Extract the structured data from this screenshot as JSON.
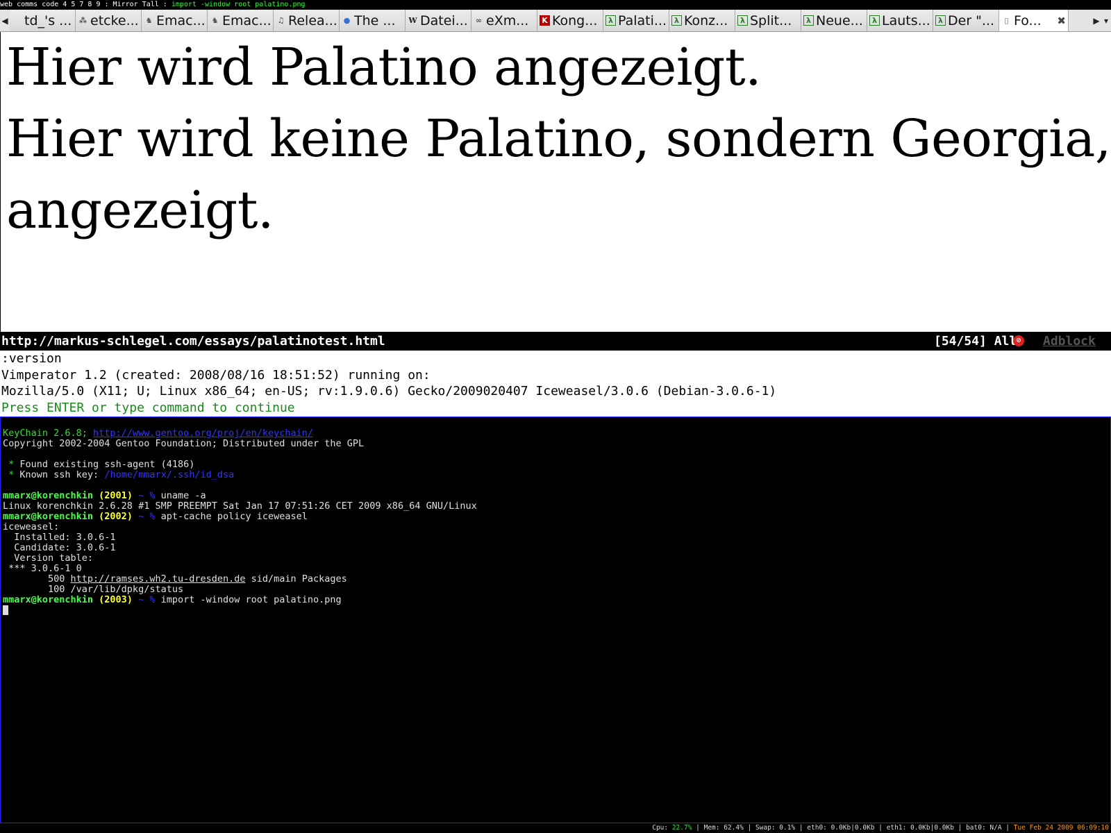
{
  "wm": {
    "left": "web comms code 4 5 7 8 9 : Mirror Tall : ",
    "command": "import -window root palatino.png"
  },
  "tabs": [
    {
      "label": "td_'s ...",
      "icon": "generic-page-icon"
    },
    {
      "label": "etcke...",
      "icon": "dots-icon"
    },
    {
      "label": "Emac...",
      "icon": "gnu-icon"
    },
    {
      "label": "Emac...",
      "icon": "gnu-icon"
    },
    {
      "label": "Relea...",
      "icon": "music-icon"
    },
    {
      "label": "The ...",
      "icon": "blue-dots-icon"
    },
    {
      "label": "Datei...",
      "icon": "wikipedia-icon"
    },
    {
      "label": "eXm...",
      "icon": "glasses-icon"
    },
    {
      "label": "Kong...",
      "icon": "k-icon"
    },
    {
      "label": "Palati...",
      "icon": "lambda-icon"
    },
    {
      "label": "Konz...",
      "icon": "lambda-icon"
    },
    {
      "label": "Split...",
      "icon": "lambda-icon"
    },
    {
      "label": "Neue...",
      "icon": "lambda-icon"
    },
    {
      "label": "Lauts...",
      "icon": "lambda-icon"
    },
    {
      "label": "Der \"...",
      "icon": "lambda-icon"
    },
    {
      "label": "Fo...",
      "icon": "document-icon",
      "active": true
    }
  ],
  "content": {
    "line1": "Hier wird Palatino angezeigt.",
    "line2": "Hier wird keine Palatino, sondern Georgia, angezeigt."
  },
  "statusbar": {
    "url": "http://markus-schlegel.com/essays/palatinotest.html",
    "position": "[54/54] All",
    "adblock": "Adblock"
  },
  "cmdout": {
    "line1": ":version",
    "line2": "Vimperator 1.2 (created: 2008/08/16 18:51:52) running on:",
    "line3": "Mozilla/5.0 (X11; U; Linux x86_64; en-US; rv:1.9.0.6) Gecko/2009020407 Iceweasel/3.0.6 (Debian-3.0.6-1)",
    "line4": "Press ENTER or type command to continue"
  },
  "terminal": {
    "keychain": "KeyChain 2.6.8; ",
    "keychain_url": "http://www.gentoo.org/proj/en/keychain/",
    "copyright": "Copyright 2002-2004 Gentoo Foundation; Distributed under the GPL",
    "found_agent": " Found existing ssh-agent (4186)",
    "known_key_label": " Known ssh key: ",
    "known_key_path": "/home/mmarx/.ssh/id_dsa",
    "user": "mmarx@korenchkin",
    "cmd1_num": " (2001) ",
    "cmd1_dir": "~ % ",
    "cmd1": "uname -a",
    "uname_out": "Linux korenchkin 2.6.28 #1 SMP PREEMPT Sat Jan 17 07:51:26 CET 2009 x86_64 GNU/Linux",
    "cmd2_num": " (2002) ",
    "cmd2": "apt-cache policy iceweasel",
    "policy1": "iceweasel:",
    "policy2": "  Installed: 3.0.6-1",
    "policy3": "  Candidate: 3.0.6-1",
    "policy4": "  Version table:",
    "policy5": " *** 3.0.6-1 0",
    "policy6_pre": "        500 ",
    "policy6_url": "http://ramses.wh2.tu-dresden.de",
    "policy6_post": " sid/main Packages",
    "policy7": "        100 /var/lib/dpkg/status",
    "cmd3_num": " (2003) ",
    "cmd3": "import -window root palatino.png"
  },
  "sysbar": {
    "cpu_label": "Cpu: ",
    "cpu": "22.7%",
    "rest": " | Mem: 62.4% | Swap: 0.1% | eth0: 0.0Kb|0.0Kb | eth1: 0.0Kb|0.0Kb | bat0: N/A | ",
    "datetime": "Tue Feb 24 2009 06:09:10"
  }
}
